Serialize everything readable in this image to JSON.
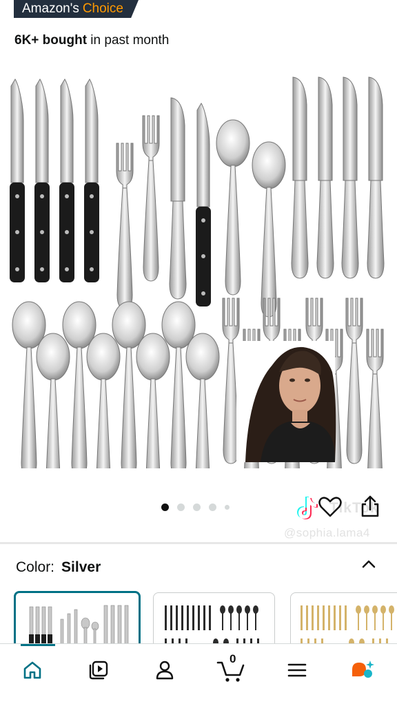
{
  "badge": {
    "prefix": "Amazon's",
    "choice": "Choice"
  },
  "bought": {
    "strong": "6K+ bought",
    "rest": " in past month"
  },
  "gallery": {
    "dots_total": 5,
    "active_index": 0
  },
  "overlay": {
    "tiktok_text": "TikTok",
    "handle": "@sophia.lama4"
  },
  "color_section": {
    "label": "Color:",
    "value": "Silver"
  },
  "swatches": [
    {
      "name": "Silver",
      "selected": true,
      "color": "#c0c0c0"
    },
    {
      "name": "Black",
      "selected": false,
      "color": "#2a2a2a"
    },
    {
      "name": "Gold",
      "selected": false,
      "color": "#d4b36a"
    }
  ],
  "bottom_nav": {
    "cart_count": "0"
  },
  "colors": {
    "accent": "#007185",
    "badge_bg": "#232f3e",
    "badge_orange": "#ff9900"
  }
}
